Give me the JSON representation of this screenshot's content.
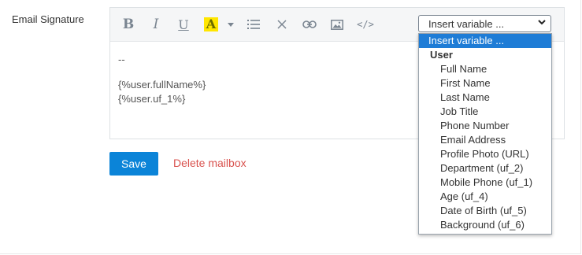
{
  "form": {
    "signature_label": "Email Signature"
  },
  "toolbar": {
    "bold_label": "B",
    "italic_label": "I",
    "underline_label": "U",
    "color_label": "A",
    "code_label": "</>",
    "highlight_color": "#ffe600",
    "icon_color": "#7a8591"
  },
  "variable_select": {
    "value": "Insert variable ..."
  },
  "editor": {
    "lines": [
      "--",
      "{%user.fullName%}",
      "{%user.uf_1%}"
    ]
  },
  "actions": {
    "save_label": "Save",
    "delete_label": "Delete mailbox",
    "save_color": "#0b84d8",
    "delete_color": "#d9534f"
  },
  "dropdown": {
    "selected": "Insert variable ...",
    "group": "User",
    "options": [
      "Full Name",
      "First Name",
      "Last Name",
      "Job Title",
      "Phone Number",
      "Email Address",
      "Profile Photo (URL)",
      "Department (uf_2)",
      "Mobile Phone (uf_1)",
      "Age (uf_4)",
      "Date of Birth (uf_5)",
      "Background (uf_6)"
    ],
    "highlight_color": "#1e7cd6"
  }
}
